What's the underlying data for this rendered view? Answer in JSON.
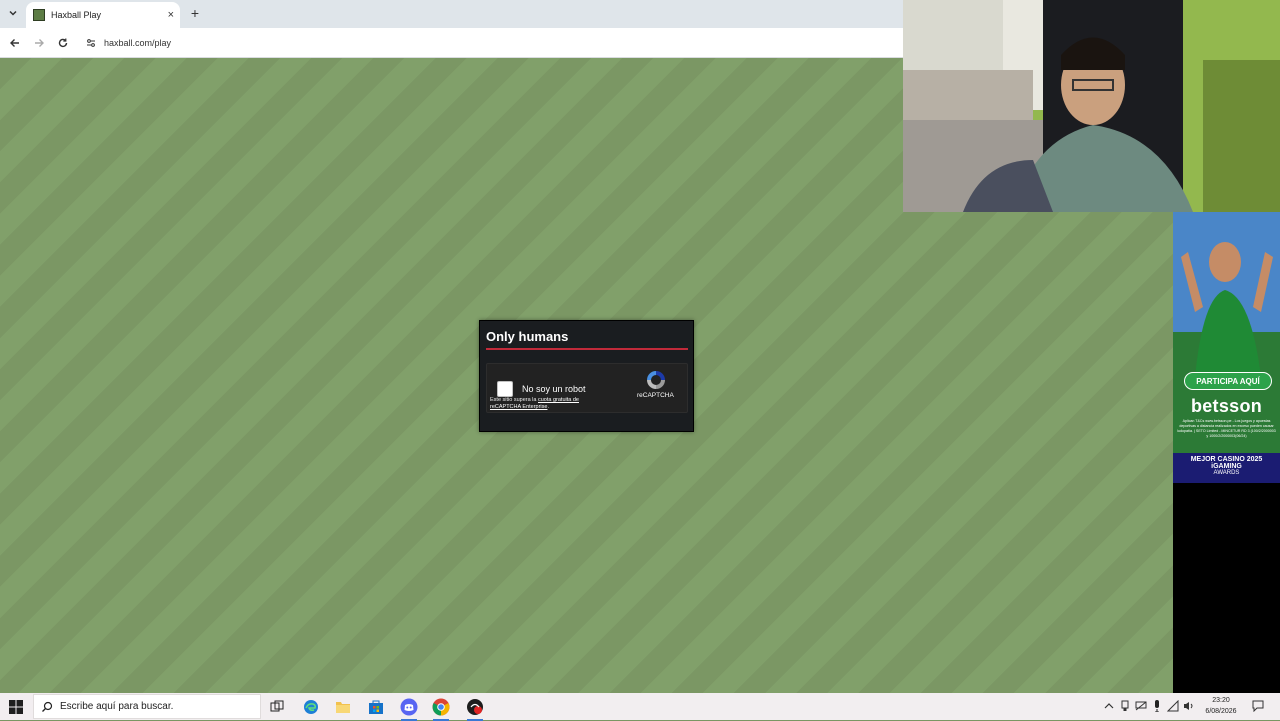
{
  "browser": {
    "tab_title": "Haxball Play",
    "url": "haxball.com/play",
    "new_tab_symbol": "+",
    "close_symbol": "×"
  },
  "dialog": {
    "title": "Only humans",
    "captcha_label": "No soy un robot",
    "captcha_note_prefix": "Este sitio supera la",
    "captcha_note_link": "cuota gratuita de reCAPTCHA Enterprise",
    "captcha_note_suffix": ".",
    "captcha_brand": "reCAPTCHA",
    "checked": false
  },
  "ad": {
    "cta": "PARTICIPA AQUÍ",
    "brand": "betsson",
    "terms": "Aplican T&Cs www.betsson.pe - Los juegos y apuestas deportivas a distancia realizados en exceso pueden causar ludopatía. | SETO Limited - MINCETUR RD 3 (100/2/2000003 y 1000/2/2000003(06/24)",
    "award_line1": "MEJOR CASINO 2025",
    "award_line2": "iGAMING",
    "award_line3": "AWARDS"
  },
  "taskbar": {
    "search_placeholder": "Escribe aquí para buscar.",
    "time": "23:20",
    "date": "6/08/2026"
  },
  "colors": {
    "pitch_a": "#7b9764",
    "pitch_b": "#81a06a",
    "dialog_bg": "#1a1d20",
    "dialog_accent": "#c12a3a",
    "ad_award_bg": "#1b1c72"
  },
  "icons": [
    "tab-menu-icon",
    "favicon-icon",
    "back-icon",
    "forward-icon",
    "reload-icon",
    "site-info-icon",
    "windows-start-icon",
    "search-icon",
    "task-view-icon",
    "edge-icon",
    "file-explorer-icon",
    "store-icon",
    "discord-icon",
    "chrome-icon",
    "app-icon",
    "recaptcha-icon"
  ]
}
